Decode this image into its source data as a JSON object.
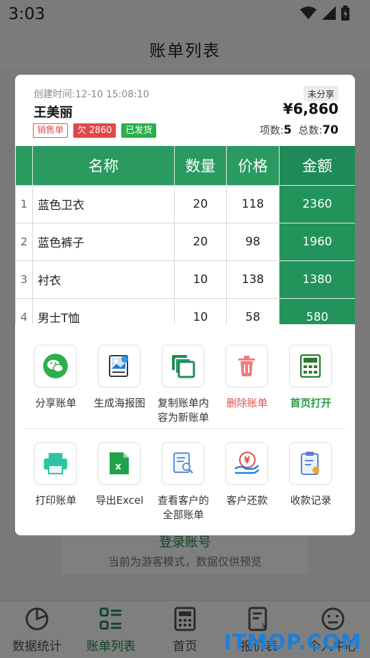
{
  "status_bar": {
    "time": "3:03"
  },
  "app": {
    "title": "账单列表"
  },
  "background_card": {
    "title": "登录账号",
    "subtitle": "当前为游客模式，数据仅供预览"
  },
  "dialog": {
    "created_at": "创建时间:12-10 15:08:10",
    "share_status": "未分享",
    "customer": "王美丽",
    "total": "¥6,860",
    "tags": {
      "sale": "销售单",
      "debt": "欠 2860",
      "shipped": "已发货"
    },
    "counts": {
      "items_label": "项数:",
      "items": "5",
      "total_label": "总数:",
      "total": "70"
    },
    "table": {
      "headers": [
        "名称",
        "数量",
        "价格",
        "金额"
      ],
      "rows": [
        {
          "idx": "1",
          "name": "蓝色卫衣",
          "qty": "20",
          "price": "118",
          "amount": "2360"
        },
        {
          "idx": "2",
          "name": "蓝色裤子",
          "qty": "20",
          "price": "98",
          "amount": "1960"
        },
        {
          "idx": "3",
          "name": "衬衣",
          "qty": "10",
          "price": "138",
          "amount": "1380"
        },
        {
          "idx": "4",
          "name": "男士T恤",
          "qty": "10",
          "price": "58",
          "amount": "580"
        }
      ]
    },
    "actions_row1": [
      {
        "label": "分享账单",
        "icon": "wechat-icon"
      },
      {
        "label": "生成海报图",
        "icon": "poster-icon"
      },
      {
        "label": "复制账单内容为新账单",
        "icon": "copy-icon"
      },
      {
        "label": "删除账单",
        "icon": "trash-icon"
      },
      {
        "label": "首页打开",
        "icon": "calculator-icon"
      }
    ],
    "actions_row2": [
      {
        "label": "打印账单",
        "icon": "printer-icon"
      },
      {
        "label": "导出Excel",
        "icon": "excel-icon"
      },
      {
        "label": "查看客户的全部账单",
        "icon": "document-search-icon"
      },
      {
        "label": "客户还款",
        "icon": "repayment-icon"
      },
      {
        "label": "收款记录",
        "icon": "clipboard-icon"
      }
    ]
  },
  "bottom_nav": [
    {
      "label": "数据统计",
      "icon": "pie-chart-icon"
    },
    {
      "label": "账单列表",
      "icon": "list-icon"
    },
    {
      "label": "首页",
      "icon": "calculator-icon"
    },
    {
      "label": "报价表",
      "icon": "price-list-icon"
    },
    {
      "label": "个人中心",
      "icon": "smile-icon"
    }
  ],
  "watermark": "ITMOP.COM",
  "colors": {
    "primary": "#1f8a57",
    "danger": "#e05050",
    "success": "#2bb04c"
  }
}
